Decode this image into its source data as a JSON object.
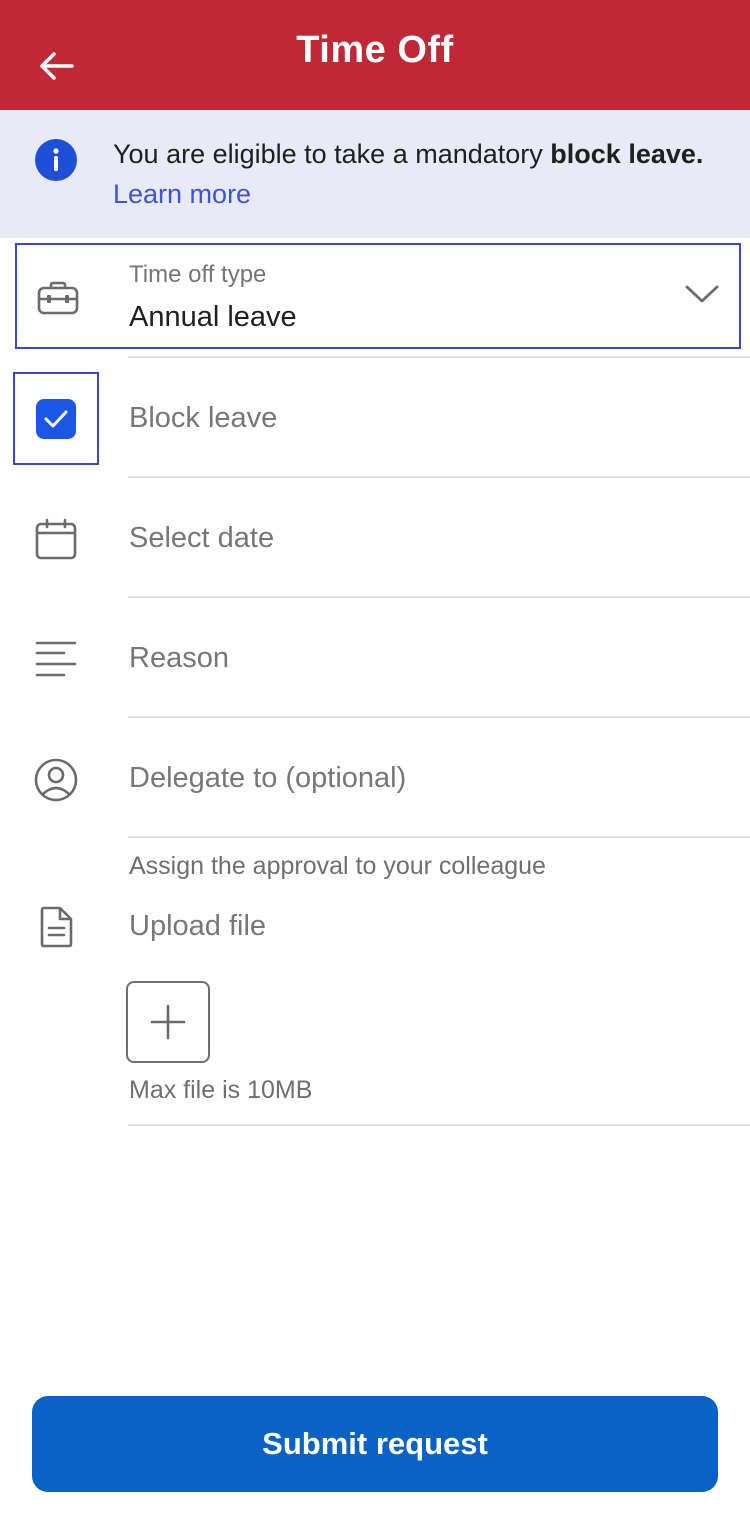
{
  "header": {
    "title": "Time Off",
    "back_icon": "arrow-left-icon"
  },
  "banner": {
    "icon": "info-icon",
    "text_prefix": "You are eligible to take a mandatory ",
    "text_bold": "block leave.",
    "link": "Learn more"
  },
  "time_off_type": {
    "icon": "briefcase-icon",
    "label": "Time off type",
    "value": "Annual leave",
    "chevron": "chevron-down-icon"
  },
  "block_leave": {
    "label": "Block leave",
    "checked": true
  },
  "date": {
    "icon": "calendar-icon",
    "placeholder": "Select date"
  },
  "reason": {
    "icon": "text-lines-icon",
    "placeholder": "Reason"
  },
  "delegate": {
    "icon": "user-circle-icon",
    "placeholder": "Delegate to (optional)",
    "hint": "Assign the approval to your colleague"
  },
  "upload": {
    "icon": "document-icon",
    "label": "Upload file",
    "add_icon": "plus-icon",
    "note": "Max file is 10MB"
  },
  "submit_label": "Submit request",
  "colors": {
    "header_bg": "#c02835",
    "banner_bg": "#e9eaf8",
    "link": "#3d55d1",
    "focus_border": "#3a48c6",
    "checkbox": "#1a56e8",
    "submit_bg": "#0a62c4"
  }
}
